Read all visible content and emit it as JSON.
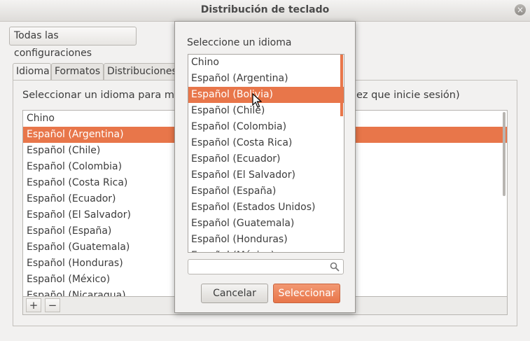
{
  "window": {
    "title": "Distribución de teclado",
    "close_label": "×"
  },
  "toolbar": {
    "all_settings_label": "Todas las configuraciones"
  },
  "tabs": [
    {
      "label": "Idioma"
    },
    {
      "label": "Formatos"
    },
    {
      "label": "Distribuciones"
    }
  ],
  "main": {
    "description_start": "Seleccionar un idioma para most",
    "description_end": "ez que inicie sesión)",
    "languages": [
      "Chino",
      "Español (Argentina)",
      "Español (Chile)",
      "Español (Colombia)",
      "Español (Costa Rica)",
      "Español (Ecuador)",
      "Español (El Salvador)",
      "Español (España)",
      "Español (Guatemala)",
      "Español (Honduras)",
      "Español (México)",
      "Español (Nicaragua)"
    ],
    "selected_language": "Español (Argentina)",
    "add_label": "+",
    "remove_label": "−"
  },
  "dialog": {
    "label": "Seleccione un idioma",
    "languages": [
      "Chino",
      "Español (Argentina)",
      "Español (Bolivia)",
      "Español (Chile)",
      "Español (Colombia)",
      "Español (Costa Rica)",
      "Español (Ecuador)",
      "Español (El Salvador)",
      "Español (España)",
      "Español (Estados Unidos)",
      "Español (Guatemala)",
      "Español (Honduras)",
      "Español (México)"
    ],
    "selected_language": "Español (Bolivia)",
    "search_value": "",
    "cancel_label": "Cancelar",
    "select_label": "Seleccionar"
  },
  "colors": {
    "accent": "#e8764a"
  }
}
